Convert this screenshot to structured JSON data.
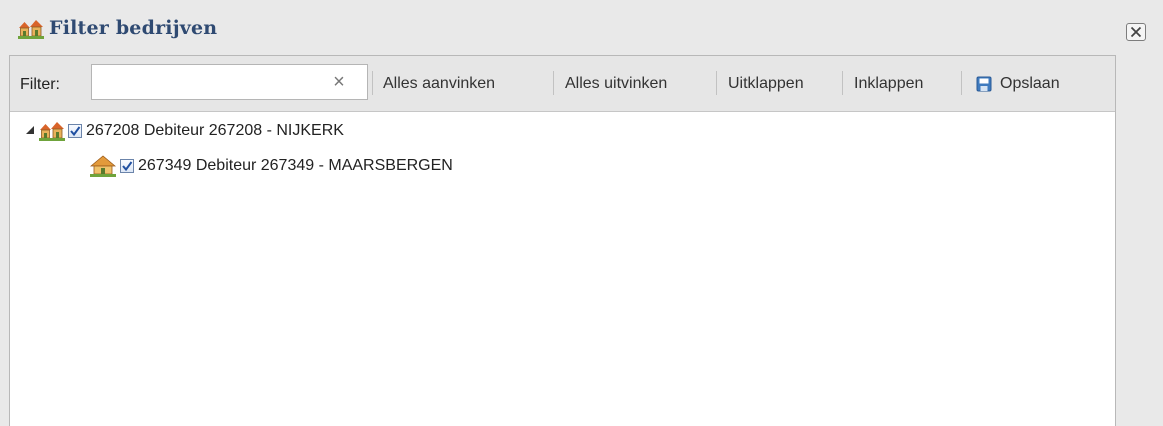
{
  "window": {
    "title": "Filter bedrijven",
    "icons": {
      "title": "companies-icon",
      "close": "close-icon"
    }
  },
  "toolbar": {
    "filter_label": "Filter:",
    "filter_value": "",
    "filter_placeholder": "",
    "clear_symbol": "×",
    "check_all": "Alles aanvinken",
    "uncheck_all": "Alles uitvinken",
    "expand": "Uitklappen",
    "collapse": "Inklappen",
    "save": "Opslaan"
  },
  "tree": [
    {
      "label": "267208 Debiteur 267208 - NIJKERK",
      "icon": "companies-icon",
      "checked": true,
      "expanded": true,
      "children": [
        {
          "label": "267349 Debiteur 267349 - MAARSBERGEN",
          "icon": "house-icon",
          "checked": true
        }
      ]
    }
  ],
  "colors": {
    "title": "#2f4a72",
    "toolbar_bg": "#e6e6e6",
    "window_bg": "#e9e9e9",
    "check_mark": "#1f4fa1"
  }
}
